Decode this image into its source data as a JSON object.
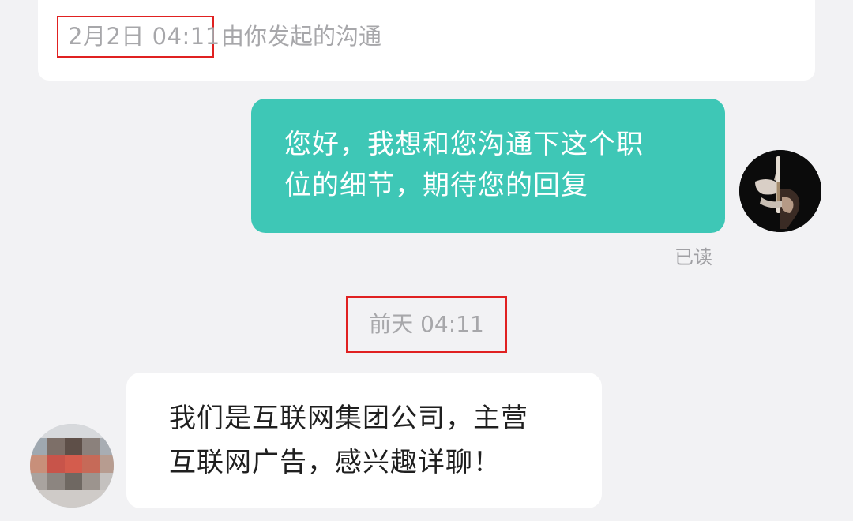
{
  "conversation_info": {
    "date": "2月2日 04:11",
    "note": "由你发起的沟通"
  },
  "messages": {
    "outgoing": {
      "line1": "您好，我想和您沟通下这个职",
      "line2": "位的细节，期待您的回复",
      "status": "已读"
    },
    "divider_time": "前天 04:11",
    "incoming": {
      "line1": "我们是互联网集团公司，主营",
      "line2": "互联网广告，感兴趣详聊！"
    }
  },
  "colors": {
    "outgoing_bubble": "#3ec7b6",
    "highlight_box": "#e02121",
    "background": "#f2f2f4"
  }
}
